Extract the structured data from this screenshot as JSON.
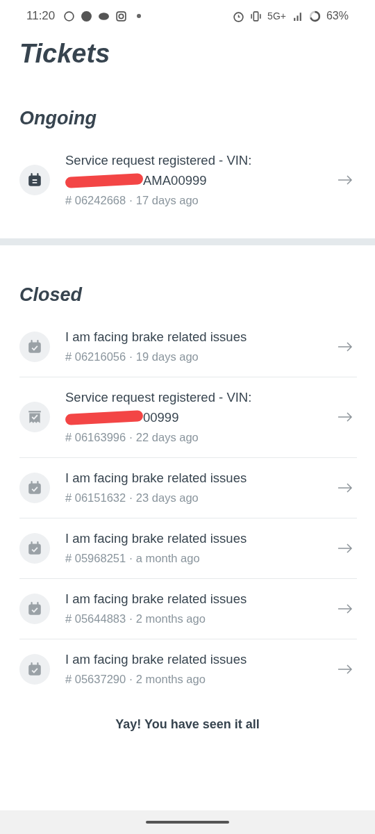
{
  "status_bar": {
    "time": "11:20",
    "network": "5G+",
    "battery": "63%"
  },
  "title": "Tickets",
  "sections": [
    {
      "heading": "Ongoing",
      "ongoing": true,
      "tickets": [
        {
          "kind": "calendar-lines",
          "title": "Service request registered - VIN:",
          "vin_visible": "AMA00999",
          "redacted": true,
          "meta": "# 06242668 · 17 days ago"
        }
      ]
    },
    {
      "heading": "Closed",
      "ongoing": false,
      "tickets": [
        {
          "kind": "calendar-check",
          "title": "I am facing brake related issues",
          "meta": "# 06216056 · 19 days ago"
        },
        {
          "kind": "receipt-check",
          "title": "Service request registered - VIN:",
          "vin_visible": "00999",
          "redacted": true,
          "meta": "# 06163996 · 22 days ago"
        },
        {
          "kind": "calendar-check",
          "title": "I am facing brake related issues",
          "meta": "# 06151632 · 23 days ago"
        },
        {
          "kind": "calendar-check",
          "title": "I am facing brake related issues",
          "meta": "# 05968251 · a month ago"
        },
        {
          "kind": "calendar-check",
          "title": "I am facing brake related issues",
          "meta": "# 05644883 · 2 months ago"
        },
        {
          "kind": "calendar-check",
          "title": "I am facing brake related issues",
          "meta": "# 05637290 · 2 months ago"
        }
      ]
    }
  ],
  "footer": "Yay! You have seen it all"
}
